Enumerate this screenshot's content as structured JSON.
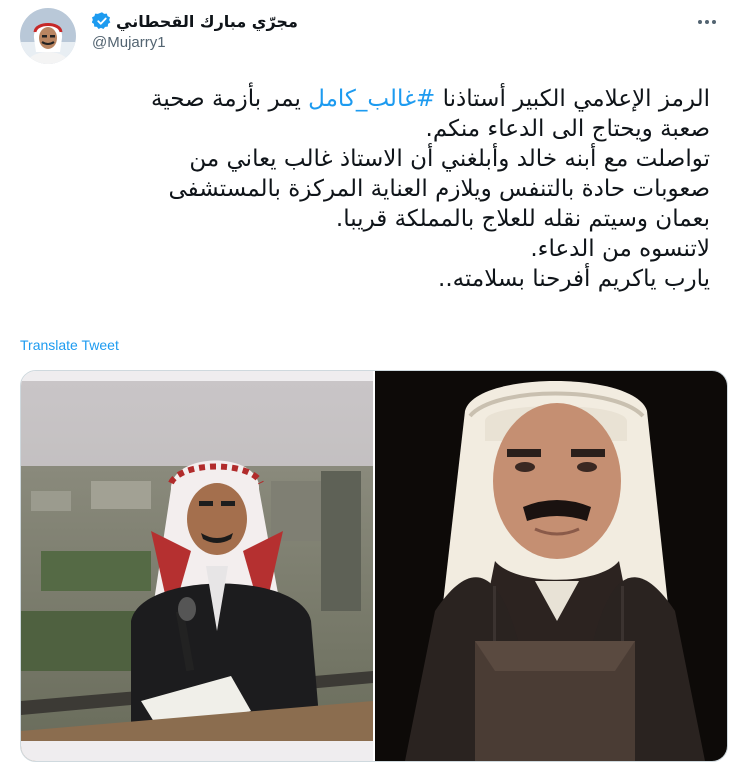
{
  "tweet": {
    "author": {
      "display_name": "مجرّي مبارك القحطاني",
      "handle": "@Mujarry1",
      "verified": true,
      "avatar_icon": "profile-photo"
    },
    "text_lines": [
      {
        "before": "الرمز الإعلامي الكبير أستاذنا ",
        "hashtag": "#غالب_كامل",
        "after": " يمر بأزمة صحية"
      },
      {
        "before": "صعبة ويحتاج الى الدعاء منكم.",
        "hashtag": "",
        "after": ""
      },
      {
        "before": "تواصلت مع أبنه خالد وأبلغني أن الاستاذ غالب يعاني من",
        "hashtag": "",
        "after": ""
      },
      {
        "before": "صعوبات حادة بالتنفس ويلازم العناية المركزة بالمستشفى",
        "hashtag": "",
        "after": ""
      },
      {
        "before": "بعمان وسيتم نقله للعلاج بالمملكة قريبا.",
        "hashtag": "",
        "after": ""
      },
      {
        "before": "لاتنسوه من الدعاء.",
        "hashtag": "",
        "after": ""
      },
      {
        "before": "يارب ياكريم أفرحنا بسلامته..",
        "hashtag": "",
        "after": ""
      }
    ],
    "translate_label": "Translate Tweet",
    "more_icon": "more-horizontal-icon",
    "media": [
      {
        "icon": "photo-man-with-microphone-on-balcony"
      },
      {
        "icon": "photo-man-in-red-ghutra-portrait"
      }
    ],
    "colors": {
      "accent": "#1d9bf0",
      "text": "#0f1419",
      "secondary": "#536471",
      "border": "#cfd9de"
    }
  }
}
